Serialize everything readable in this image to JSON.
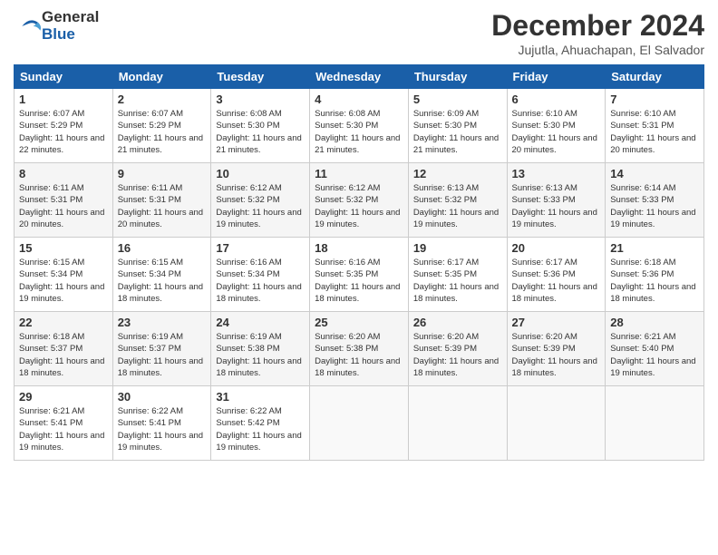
{
  "logo": {
    "general": "General",
    "blue": "Blue"
  },
  "title": "December 2024",
  "location": "Jujutla, Ahuachapan, El Salvador",
  "weekdays": [
    "Sunday",
    "Monday",
    "Tuesday",
    "Wednesday",
    "Thursday",
    "Friday",
    "Saturday"
  ],
  "weeks": [
    [
      {
        "day": "1",
        "sunrise": "6:07 AM",
        "sunset": "5:29 PM",
        "daylight": "11 hours and 22 minutes."
      },
      {
        "day": "2",
        "sunrise": "6:07 AM",
        "sunset": "5:29 PM",
        "daylight": "11 hours and 21 minutes."
      },
      {
        "day": "3",
        "sunrise": "6:08 AM",
        "sunset": "5:30 PM",
        "daylight": "11 hours and 21 minutes."
      },
      {
        "day": "4",
        "sunrise": "6:08 AM",
        "sunset": "5:30 PM",
        "daylight": "11 hours and 21 minutes."
      },
      {
        "day": "5",
        "sunrise": "6:09 AM",
        "sunset": "5:30 PM",
        "daylight": "11 hours and 21 minutes."
      },
      {
        "day": "6",
        "sunrise": "6:10 AM",
        "sunset": "5:30 PM",
        "daylight": "11 hours and 20 minutes."
      },
      {
        "day": "7",
        "sunrise": "6:10 AM",
        "sunset": "5:31 PM",
        "daylight": "11 hours and 20 minutes."
      }
    ],
    [
      {
        "day": "8",
        "sunrise": "6:11 AM",
        "sunset": "5:31 PM",
        "daylight": "11 hours and 20 minutes."
      },
      {
        "day": "9",
        "sunrise": "6:11 AM",
        "sunset": "5:31 PM",
        "daylight": "11 hours and 20 minutes."
      },
      {
        "day": "10",
        "sunrise": "6:12 AM",
        "sunset": "5:32 PM",
        "daylight": "11 hours and 19 minutes."
      },
      {
        "day": "11",
        "sunrise": "6:12 AM",
        "sunset": "5:32 PM",
        "daylight": "11 hours and 19 minutes."
      },
      {
        "day": "12",
        "sunrise": "6:13 AM",
        "sunset": "5:32 PM",
        "daylight": "11 hours and 19 minutes."
      },
      {
        "day": "13",
        "sunrise": "6:13 AM",
        "sunset": "5:33 PM",
        "daylight": "11 hours and 19 minutes."
      },
      {
        "day": "14",
        "sunrise": "6:14 AM",
        "sunset": "5:33 PM",
        "daylight": "11 hours and 19 minutes."
      }
    ],
    [
      {
        "day": "15",
        "sunrise": "6:15 AM",
        "sunset": "5:34 PM",
        "daylight": "11 hours and 19 minutes."
      },
      {
        "day": "16",
        "sunrise": "6:15 AM",
        "sunset": "5:34 PM",
        "daylight": "11 hours and 18 minutes."
      },
      {
        "day": "17",
        "sunrise": "6:16 AM",
        "sunset": "5:34 PM",
        "daylight": "11 hours and 18 minutes."
      },
      {
        "day": "18",
        "sunrise": "6:16 AM",
        "sunset": "5:35 PM",
        "daylight": "11 hours and 18 minutes."
      },
      {
        "day": "19",
        "sunrise": "6:17 AM",
        "sunset": "5:35 PM",
        "daylight": "11 hours and 18 minutes."
      },
      {
        "day": "20",
        "sunrise": "6:17 AM",
        "sunset": "5:36 PM",
        "daylight": "11 hours and 18 minutes."
      },
      {
        "day": "21",
        "sunrise": "6:18 AM",
        "sunset": "5:36 PM",
        "daylight": "11 hours and 18 minutes."
      }
    ],
    [
      {
        "day": "22",
        "sunrise": "6:18 AM",
        "sunset": "5:37 PM",
        "daylight": "11 hours and 18 minutes."
      },
      {
        "day": "23",
        "sunrise": "6:19 AM",
        "sunset": "5:37 PM",
        "daylight": "11 hours and 18 minutes."
      },
      {
        "day": "24",
        "sunrise": "6:19 AM",
        "sunset": "5:38 PM",
        "daylight": "11 hours and 18 minutes."
      },
      {
        "day": "25",
        "sunrise": "6:20 AM",
        "sunset": "5:38 PM",
        "daylight": "11 hours and 18 minutes."
      },
      {
        "day": "26",
        "sunrise": "6:20 AM",
        "sunset": "5:39 PM",
        "daylight": "11 hours and 18 minutes."
      },
      {
        "day": "27",
        "sunrise": "6:20 AM",
        "sunset": "5:39 PM",
        "daylight": "11 hours and 18 minutes."
      },
      {
        "day": "28",
        "sunrise": "6:21 AM",
        "sunset": "5:40 PM",
        "daylight": "11 hours and 19 minutes."
      }
    ],
    [
      {
        "day": "29",
        "sunrise": "6:21 AM",
        "sunset": "5:41 PM",
        "daylight": "11 hours and 19 minutes."
      },
      {
        "day": "30",
        "sunrise": "6:22 AM",
        "sunset": "5:41 PM",
        "daylight": "11 hours and 19 minutes."
      },
      {
        "day": "31",
        "sunrise": "6:22 AM",
        "sunset": "5:42 PM",
        "daylight": "11 hours and 19 minutes."
      },
      null,
      null,
      null,
      null
    ]
  ]
}
